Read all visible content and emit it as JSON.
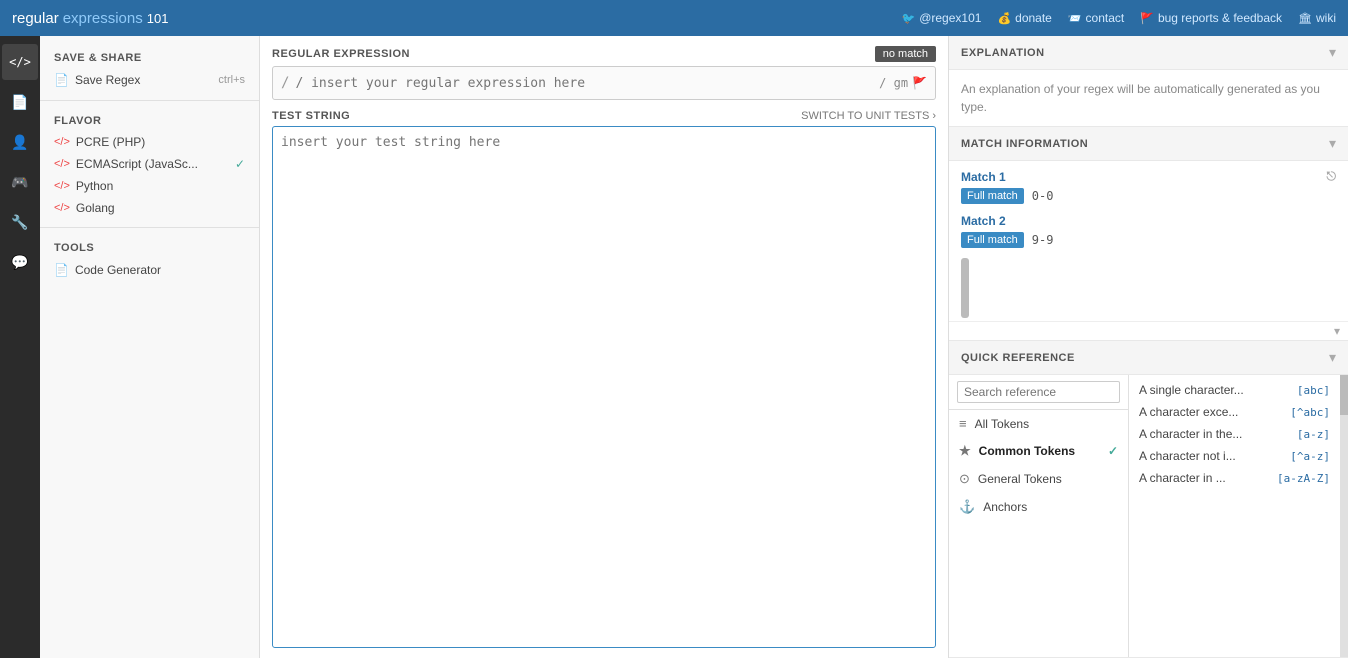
{
  "navbar": {
    "logo_regular": "regular",
    "logo_expressions": "expressions",
    "logo_101": "101",
    "links": [
      {
        "icon": "🐦",
        "label": "@regex101",
        "name": "twitter-link"
      },
      {
        "icon": "💰",
        "label": "donate",
        "name": "donate-link"
      },
      {
        "icon": "📨",
        "label": "contact",
        "name": "contact-link"
      },
      {
        "icon": "🚩",
        "label": "bug reports & feedback",
        "name": "bugreport-link"
      },
      {
        "icon": "🏛",
        "label": "wiki",
        "name": "wiki-link"
      }
    ]
  },
  "icon_sidebar": {
    "items": [
      {
        "icon": "</>",
        "name": "code-icon",
        "title": "Code"
      },
      {
        "icon": "📄",
        "name": "docs-icon",
        "title": "Docs"
      },
      {
        "icon": "👤",
        "name": "user-icon",
        "title": "User"
      },
      {
        "icon": "🎮",
        "name": "tools-icon2",
        "title": "Tools"
      },
      {
        "icon": "🔧",
        "name": "wrench-icon",
        "title": "Settings"
      },
      {
        "icon": "💬",
        "name": "chat-icon",
        "title": "Chat"
      }
    ]
  },
  "left_panel": {
    "save_share_title": "SAVE & SHARE",
    "save_regex_label": "Save Regex",
    "save_regex_shortcut": "ctrl+s",
    "flavor_title": "FLAVOR",
    "flavors": [
      {
        "label": "PCRE (PHP)",
        "name": "pcre-flavor",
        "active": false
      },
      {
        "label": "ECMAScript (JavaSc...",
        "name": "ecmascript-flavor",
        "active": true
      },
      {
        "label": "Python",
        "name": "python-flavor",
        "active": false
      },
      {
        "label": "Golang",
        "name": "golang-flavor",
        "active": false
      }
    ],
    "tools_title": "TOOLS",
    "code_generator_label": "Code Generator"
  },
  "center_panel": {
    "regex_label": "REGULAR EXPRESSION",
    "no_match_badge": "no match",
    "regex_placeholder": "/ insert your regular expression here",
    "regex_flags": "/ gm",
    "test_string_label": "TEST STRING",
    "switch_unit_tests": "SWITCH TO UNIT TESTS",
    "test_placeholder": "insert your test string here"
  },
  "right_panel": {
    "explanation": {
      "title": "EXPLANATION",
      "content": "An explanation of your regex will be automatically generated as you type."
    },
    "match_info": {
      "title": "MATCH INFORMATION",
      "matches": [
        {
          "label": "Match 1",
          "badge": "Full match",
          "range": "0-0"
        },
        {
          "label": "Match 2",
          "badge": "Full match",
          "range": "9-9"
        }
      ]
    },
    "quick_ref": {
      "title": "QUICK REFERENCE",
      "search_placeholder": "Search reference",
      "tokens": [
        {
          "icon": "≡",
          "label": "All Tokens",
          "active": false
        },
        {
          "icon": "★",
          "label": "Common Tokens",
          "active": true
        },
        {
          "icon": "⊙",
          "label": "General Tokens",
          "active": false
        },
        {
          "icon": "⚓",
          "label": "Anchors",
          "active": false
        }
      ],
      "refs": [
        {
          "desc": "A single character...",
          "code": "[abc]"
        },
        {
          "desc": "A character exce...",
          "code": "[^abc]"
        },
        {
          "desc": "A character in the...",
          "code": "[a-z]"
        },
        {
          "desc": "A character not i...",
          "code": "[^a-z]"
        },
        {
          "desc": "A character in ...",
          "code": "[a-zA-Z]"
        }
      ]
    }
  }
}
